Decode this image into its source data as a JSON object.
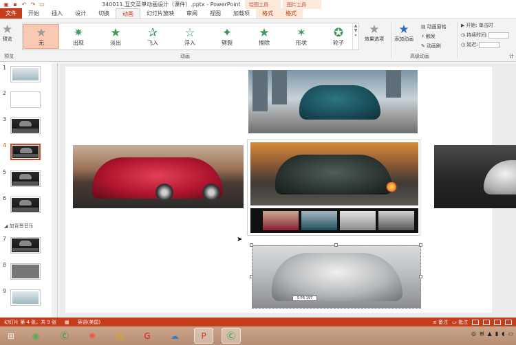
{
  "window": {
    "title": "340011.互交菜单动画设计（课件）.pptx - PowerPoint",
    "context_tab_1": "绘图工具",
    "context_tab_2": "图片工具"
  },
  "tabs": [
    "文件",
    "开始",
    "插入",
    "设计",
    "切换",
    "动画",
    "幻灯片放映",
    "审阅",
    "视图",
    "加载项",
    "格式",
    "格式"
  ],
  "ribbon": {
    "preview_label": "预览",
    "preview_group": "预览",
    "animation_group": "动画",
    "animations": [
      "无",
      "出现",
      "淡出",
      "飞入",
      "浮入",
      "劈裂",
      "擦除",
      "形状",
      "轮子"
    ],
    "effect_options": "效果选项",
    "add_animation": "添加动画",
    "advanced_group": "高级动画",
    "animation_pane": "动画窗格",
    "trigger": "触发",
    "animation_painter": "动画刷",
    "start_label": "开始:",
    "start_value": "单击时",
    "duration_label": "持续时间:",
    "delay_label": "延迟:",
    "timing_group": "计"
  },
  "thumbnails": {
    "numbers": [
      "1",
      "2",
      "3",
      "4",
      "5",
      "6",
      "7",
      "8",
      "9"
    ],
    "section_label": "加背景音乐"
  },
  "slide": {
    "plate_text": "S·PR 197"
  },
  "statusbar": {
    "slide_info": "幻灯片 第 4 张，共 9 张",
    "language": "英语(美国)",
    "notes": "备注",
    "comments": "批注"
  },
  "colors": {
    "accent": "#c43e1c",
    "ribbon_bg": "#f3f3f3",
    "selected_animation": "#f9c9b4"
  }
}
